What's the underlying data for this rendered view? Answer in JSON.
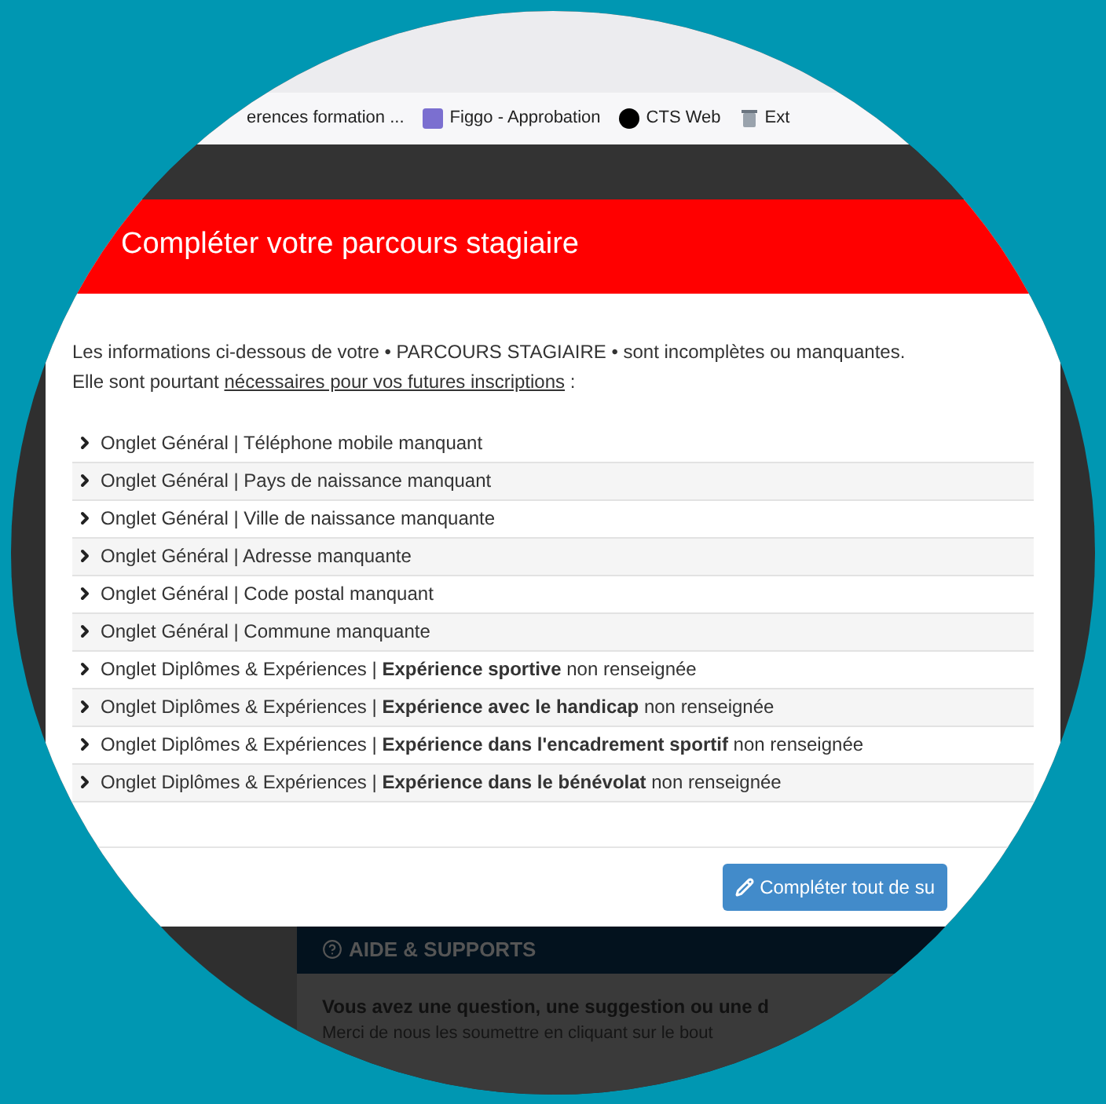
{
  "bookmarks": [
    {
      "label": "erences formation ...",
      "kind": "none"
    },
    {
      "label": "Figgo - Approbation",
      "kind": "figgo"
    },
    {
      "label": "CTS Web",
      "kind": "cts"
    },
    {
      "label": "Ext",
      "kind": "ext"
    }
  ],
  "modal": {
    "title": "Compléter votre parcours stagiaire",
    "intro_line": "Les informations ci-dessous de votre • PARCOURS STAGIAIRE • sont incomplètes ou manquantes.",
    "intro_prefix": "Elle sont pourtant",
    "intro_link": "nécessaires pour vos futures inscriptions",
    "intro_suffix": ":",
    "items": [
      {
        "text": "Onglet Général | Téléphone mobile manquant"
      },
      {
        "text": "Onglet Général | Pays de naissance manquant"
      },
      {
        "text": "Onglet Général | Ville de naissance manquante"
      },
      {
        "text": "Onglet Général | Adresse manquante"
      },
      {
        "text": "Onglet Général | Code postal manquant"
      },
      {
        "text": "Onglet Général | Commune manquante"
      },
      {
        "text": "Onglet Diplômes & Expériences | **Expérience sportive** non renseignée"
      },
      {
        "text": "Onglet Diplômes & Expériences | **Expérience avec le handicap** non renseignée"
      },
      {
        "text": "Onglet Diplômes & Expériences | **Expérience dans l'encadrement sportif** non renseignée"
      },
      {
        "text": "Onglet Diplômes & Expériences | **Expérience dans le bénévolat** non renseignée"
      }
    ],
    "button": "Compléter tout de su"
  },
  "help_panel": {
    "title": "AIDE & SUPPORTS",
    "question": "Vous avez une question, une suggestion ou une d",
    "text": "Merci de nous les soumettre en cliquant sur le bout"
  }
}
